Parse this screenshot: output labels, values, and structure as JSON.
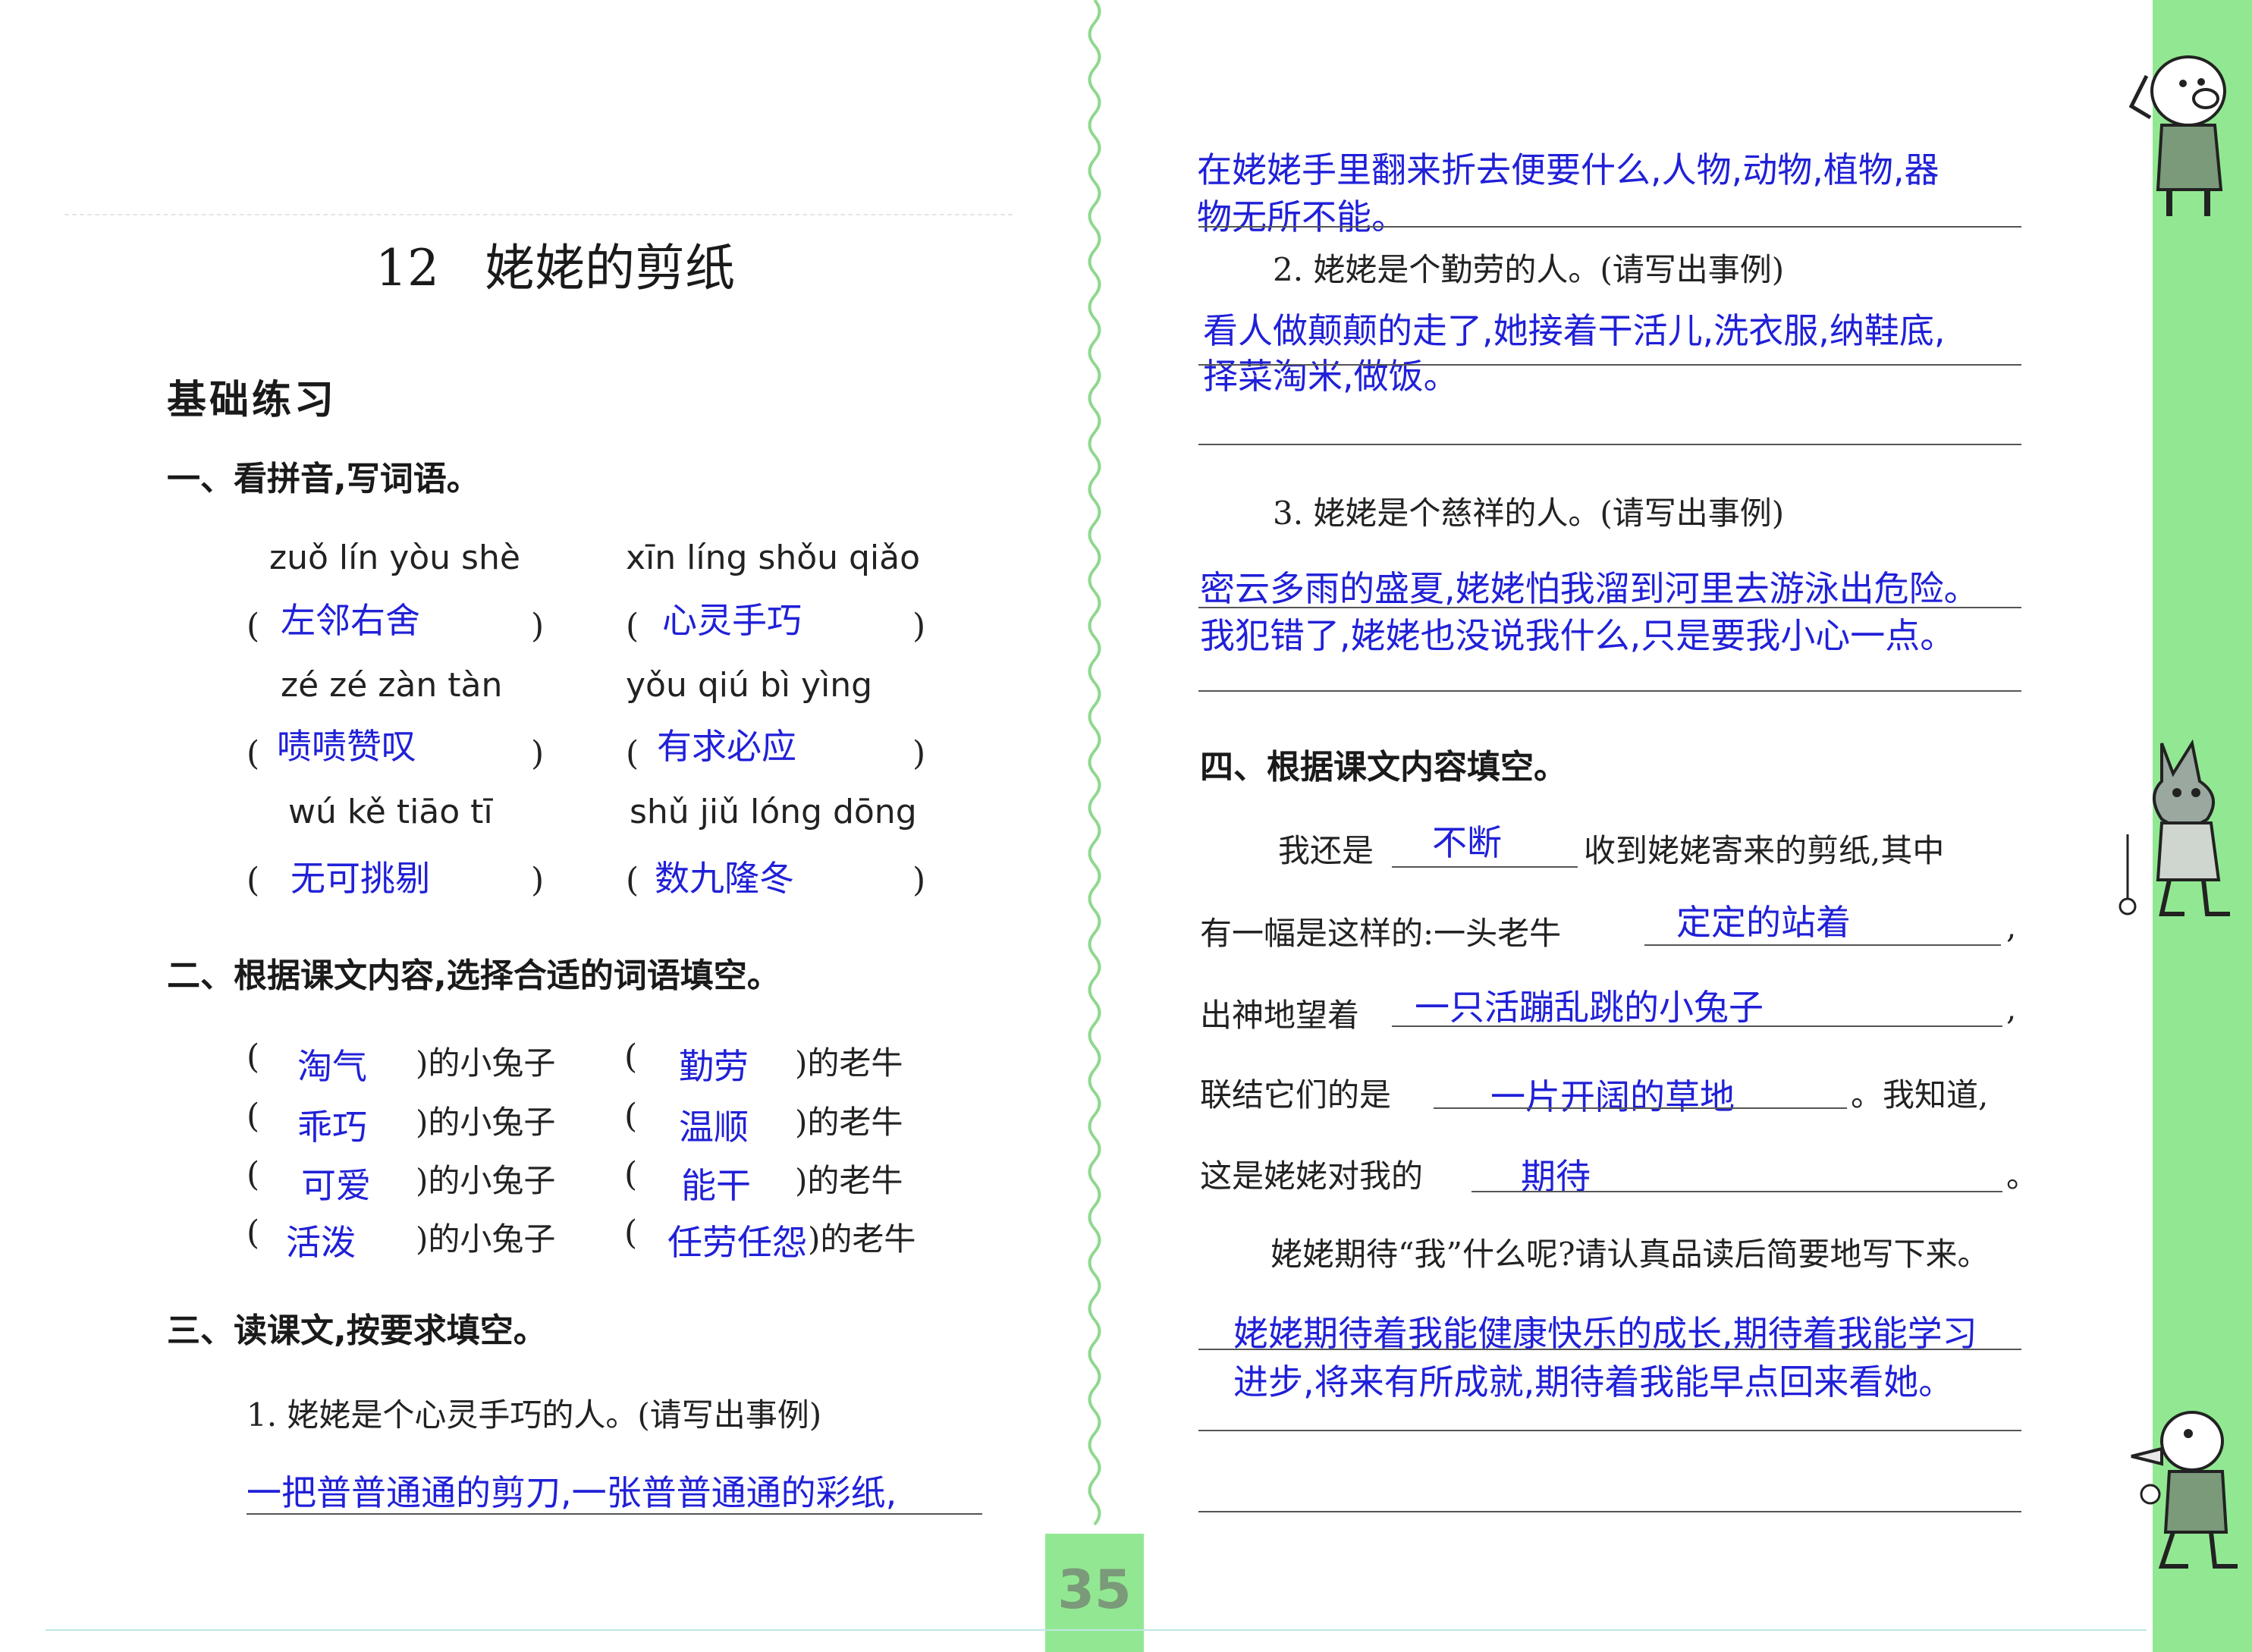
{
  "left": {
    "title_number": "12",
    "title": "姥姥的剪纸",
    "section_basic": "基础练习",
    "q1_heading": "一、看拼音,写词语。",
    "pinyin_items": [
      {
        "pinyin": "zuǒ lín yòu shè",
        "answer": "左邻右舍"
      },
      {
        "pinyin": "xīn líng shǒu qiǎo",
        "answer": "心灵手巧"
      },
      {
        "pinyin": "zé zé zàn tàn",
        "answer": "啧啧赞叹"
      },
      {
        "pinyin": "yǒu qiú bì yìng",
        "answer": "有求必应"
      },
      {
        "pinyin": "wú kě tiāo tī",
        "answer": "无可挑剔"
      },
      {
        "pinyin": "shǔ jiǔ lóng dōng",
        "answer": "数九隆冬"
      }
    ],
    "paren_open": "(",
    "paren_close": ")",
    "q2_heading": "二、根据课文内容,选择合适的词语填空。",
    "q2_suffix_rabbit": ")的小兔子",
    "q2_suffix_ox": ")的老牛",
    "q2_rows": [
      {
        "rabbit": "淘气",
        "ox": "勤劳"
      },
      {
        "rabbit": "乖巧",
        "ox": "温顺"
      },
      {
        "rabbit": "可爱",
        "ox": "能干"
      },
      {
        "rabbit": "活泼",
        "ox": "任劳任怨"
      }
    ],
    "q3_heading": "三、读课文,按要求填空。",
    "q3_1": "1. 姥姥是个心灵手巧的人。(请写出事例)",
    "q3_1_answer": "一把普普通通的剪刀,一张普普通通的彩纸,",
    "page_number": "35"
  },
  "right": {
    "q3_1_answer_cont": [
      "在姥姥手里翻来折去便要什么,人物,动物,植物,器",
      "物无所不能。"
    ],
    "q3_2": "2. 姥姥是个勤劳的人。(请写出事例)",
    "q3_2_answer": [
      "看人做颠颠的走了,她接着干活儿,洗衣服,纳鞋底,",
      "择菜淘米,做饭。"
    ],
    "q3_3": "3. 姥姥是个慈祥的人。(请写出事例)",
    "q3_3_answer": [
      "密云多雨的盛夏,姥姥怕我溜到河里去游泳出危险。",
      "我犯错了,姥姥也没说我什么,只是要我小心一点。"
    ],
    "q4_heading": "四、根据课文内容填空。",
    "q4_line1_pre": "我还是",
    "q4_line1_fill": "不断",
    "q4_line1_post": "收到姥姥寄来的剪纸,其中",
    "q4_line2_pre": "有一幅是这样的:一头老牛",
    "q4_line2_fill": "定定的站着",
    "q4_line3_pre": "出神地望着",
    "q4_line3_fill": "一只活蹦乱跳的小兔子",
    "q4_line4_pre": "联结它们的是",
    "q4_line4_fill": "一片开阔的草地",
    "q4_line4_post": "。我知道,",
    "q4_line5_pre": "这是姥姥对我的",
    "q4_line5_fill": "期待",
    "comma": ",",
    "period": "。",
    "q4_prompt": "姥姥期待“我”什么呢?请认真品读后简要地写下来。",
    "q4_answer": [
      "姥姥期待着我能健康快乐的成长,期待着我能学习",
      "进步,将来有所成就,期待着我能早点回来看她。"
    ]
  },
  "colors": {
    "answer_blue": "#2020d8",
    "sidebar_green": "#92e892"
  },
  "icons": [
    "pig-mascot-icon",
    "wolf-mascot-icon",
    "duck-mascot-icon",
    "wavy-divider-icon"
  ]
}
